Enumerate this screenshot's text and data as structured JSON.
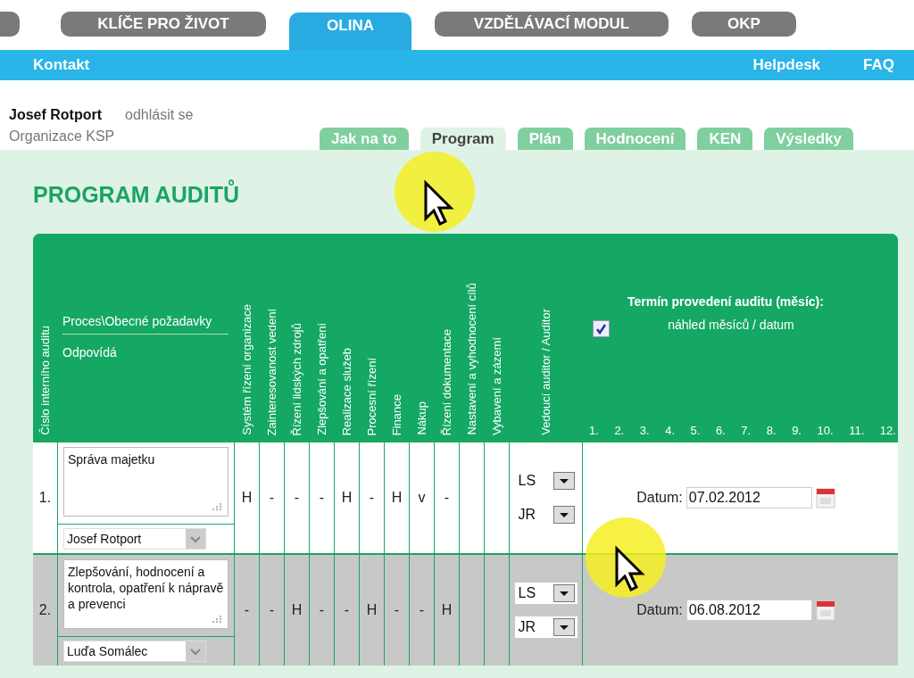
{
  "top_tabs": [
    {
      "label": "KLÍČE PRO ŽIVOT",
      "selected": false
    },
    {
      "label": "OLINA",
      "selected": true
    },
    {
      "label": "VZDĚLÁVACÍ MODUL",
      "selected": false
    },
    {
      "label": "OKP",
      "selected": false
    }
  ],
  "top_bar": {
    "left_links": [
      "Kontakt"
    ],
    "right_links": [
      "Helpdesk",
      "FAQ"
    ]
  },
  "user": {
    "name": "Josef Rotport",
    "logout": "odhlásit se",
    "organization": "Organizace KSP"
  },
  "sub_tabs": [
    {
      "label": "Jak na to",
      "selected": false
    },
    {
      "label": "Program",
      "selected": true
    },
    {
      "label": "Plán",
      "selected": false
    },
    {
      "label": "Hodnocení",
      "selected": false
    },
    {
      "label": "KEN",
      "selected": false
    },
    {
      "label": "Výsledky",
      "selected": false
    }
  ],
  "title": "PROGRAM AUDITŮ",
  "table": {
    "columns": {
      "number": "Číslo interního auditu",
      "process": "Proces\\Obecné požadavky",
      "responsible": "Odpovídá",
      "flags": [
        "Systém řízení organizace",
        "Zainteresovanost vedení",
        "Řízení lidských zdrojů",
        "Zlepšování a opatření",
        "Realizace služeb",
        "Procesní řízení",
        "Finance",
        "Nákup",
        "Řízení dokumentace",
        "Nastavení a vyhodnocení cílů",
        "Vybavení a zázemí"
      ],
      "auditor": "Vedoucí auditor / Auditor",
      "term": {
        "title": "Termín provedení auditu (měsíc):",
        "toggle_label": "náhled měsíců / datum",
        "checked": true
      },
      "months": [
        "1.",
        "2.",
        "3.",
        "4.",
        "5.",
        "6.",
        "7.",
        "8.",
        "9.",
        "10.",
        "11.",
        "12."
      ]
    },
    "rows": [
      {
        "number": "1.",
        "process": "Správa majetku",
        "responsible": "Josef Rotport",
        "flags": [
          "H",
          "-",
          "-",
          "-",
          "H",
          "-",
          "H",
          "v",
          "-"
        ],
        "lead_auditor": "LS",
        "auditor": "JR",
        "date_label": "Datum:",
        "date": "07.02.2012"
      },
      {
        "number": "2.",
        "process": "Zlepšování, hodnocení a kontrola, opatření k nápravě a prevenci",
        "responsible": "Luďa Somálec",
        "flags": [
          "-",
          "-",
          "H",
          "-",
          "-",
          "H",
          "-",
          "-",
          "H"
        ],
        "lead_auditor": "LS",
        "auditor": "JR",
        "date_label": "Datum:",
        "date": "06.08.2012"
      }
    ]
  }
}
